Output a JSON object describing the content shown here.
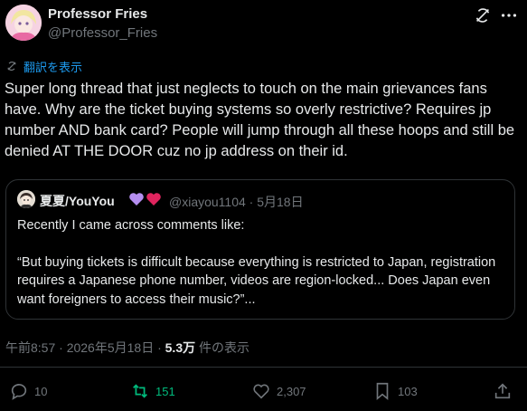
{
  "author": {
    "name": "Professor Fries",
    "handle": "@Professor_Fries"
  },
  "translate_label": "翻訳を表示",
  "post_text": "Super long thread that just neglects to touch on the main grievances fans have. Why are the ticket buying systems so overly restrictive? Requires jp number AND bank card? People will jump through all these hoops and still be denied AT THE DOOR cuz no jp address on their id.",
  "quote": {
    "name": "夏夏/YouYou",
    "handle_date": "@xiayou1104 · 5月18日",
    "para1": "Recently I came across comments like:",
    "para2": "“But buying tickets is difficult because everything is restricted to Japan, registration requires a Japanese phone number, videos are region-locked... Does Japan even want foreigners to access their music?”..."
  },
  "meta": {
    "time_date": "午前8:57 · 2026年5月18日 · ",
    "views_count": "5.3万",
    "views_label": " 件の表示"
  },
  "actions": {
    "replies": "10",
    "reposts": "151",
    "likes": "2,307",
    "bookmarks": "103"
  },
  "colors": {
    "background": "#000000",
    "text": "#e7e9ea",
    "muted": "#71767b",
    "link": "#1d9bf0",
    "repost": "#00ba7c"
  }
}
